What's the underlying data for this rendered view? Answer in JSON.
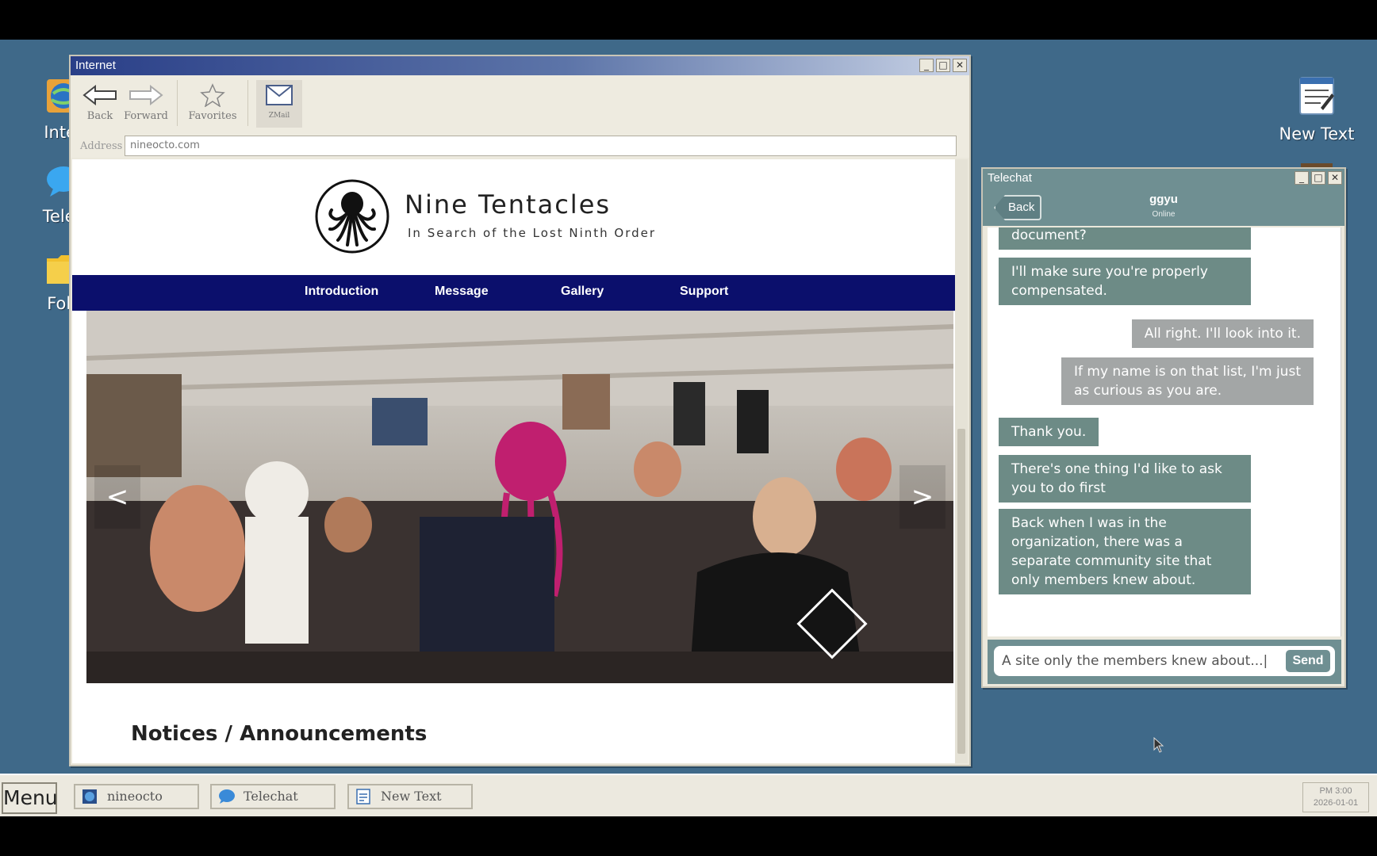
{
  "desktop": {
    "icons": [
      {
        "label": "Inter",
        "icon": "internet-globe-icon"
      },
      {
        "label": "Telec",
        "icon": "chat-bubble-icon"
      },
      {
        "label": "Folc",
        "icon": "folder-icon"
      },
      {
        "label": "New Text",
        "icon": "notepad-icon"
      }
    ]
  },
  "browser": {
    "title": "Internet",
    "toolbar": {
      "back": "Back",
      "forward": "Forward",
      "favorites": "Favorites",
      "zmail": "ZMail"
    },
    "address_label": "Address",
    "address_value": "nineocto.com",
    "site": {
      "title": "Nine Tentacles",
      "subtitle": "In Search of the Lost Ninth Order",
      "nav": [
        "Introduction",
        "Message",
        "Gallery",
        "Support"
      ],
      "carousel_prev": "<",
      "carousel_next": ">",
      "section_heading": "Notices / Announcements"
    }
  },
  "telechat": {
    "title": "Telechat",
    "back": "Back",
    "contact_name": "ggyu",
    "contact_status": "Online",
    "messages": [
      {
        "from": "contact",
        "text": "document?"
      },
      {
        "from": "contact",
        "text": "I'll make sure you're properly compensated."
      },
      {
        "from": "me",
        "text": "All right. I'll look into it."
      },
      {
        "from": "me",
        "text": "If my name is on that list, I'm just as curious as you are."
      },
      {
        "from": "contact",
        "text": "Thank you."
      },
      {
        "from": "contact",
        "text": "There's one thing I'd like to ask you to do first"
      },
      {
        "from": "contact",
        "text": "Back when I was in the organization, there was a separate community site that only members knew about."
      }
    ],
    "input_value": "A site only the members knew about...|",
    "send": "Send"
  },
  "taskbar": {
    "menu": "Menu",
    "items": [
      "nineocto",
      "Telechat",
      "New Text"
    ],
    "clock_time": "PM 3:00",
    "clock_date": "2026-01-01"
  },
  "colors": {
    "desktop": "#3f6989",
    "site_nav": "#0b0f6c",
    "chat_incoming": "#6d8b86",
    "chat_outgoing": "#a3a6a6",
    "chat_header": "#6f8f92"
  }
}
